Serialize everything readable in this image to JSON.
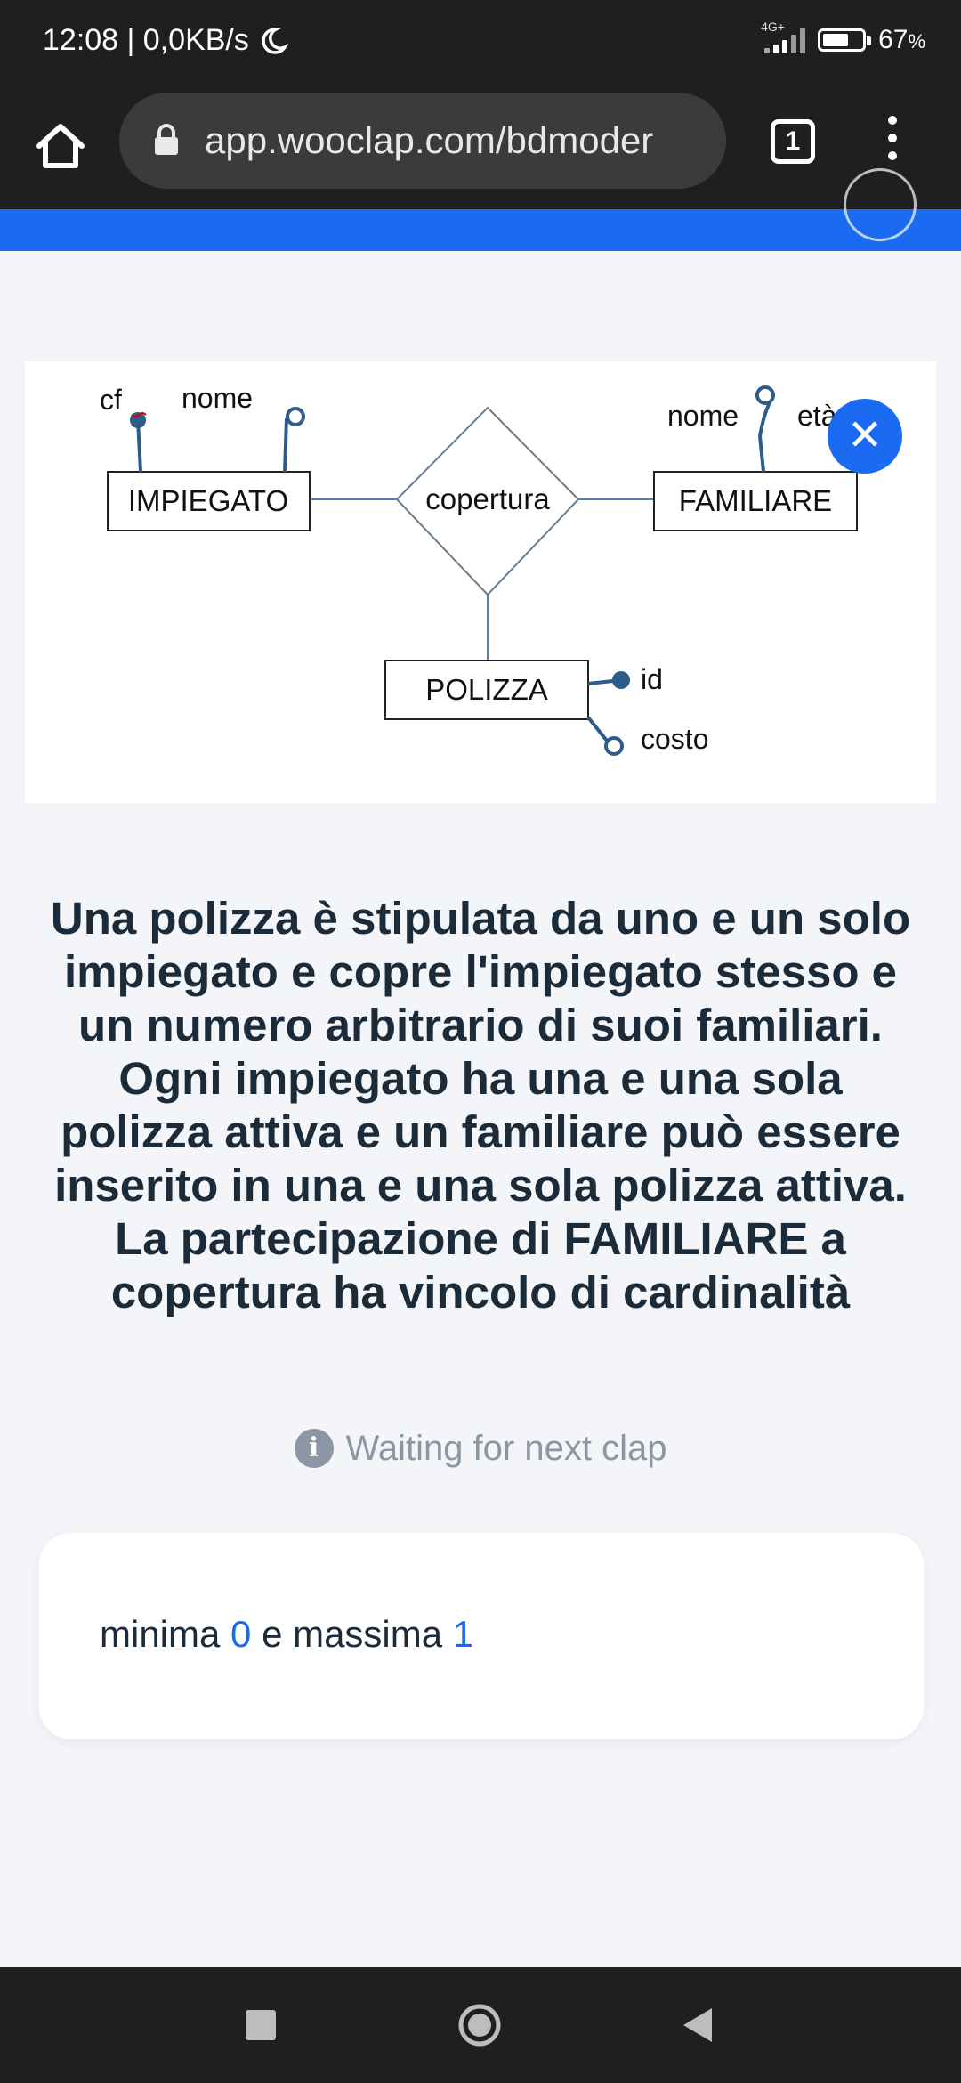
{
  "status_bar": {
    "time_speed": "12:08 | 0,0KB/s",
    "network": "4G+",
    "battery": "67",
    "battery_unit": "%",
    "battery_level": 0.67
  },
  "browser": {
    "url": "app.wooclap.com/bdmoder",
    "tab_count": "1"
  },
  "diagram": {
    "entities": [
      "IMPIEGATO",
      "FAMILIARE",
      "POLIZZA"
    ],
    "relationship": "copertura",
    "attributes": {
      "impiegato": [
        "cf",
        "nome"
      ],
      "familiare": [
        "nome",
        "età"
      ],
      "polizza": [
        "id",
        "costo"
      ]
    }
  },
  "question": {
    "lines": [
      "Una polizza è stipulata da uno e un solo",
      "impiegato e copre l'impiegato stesso e",
      "un numero arbitrario di suoi familiari.",
      "Ogni impiegato ha una e una sola",
      "polizza attiva e un familiare può essere",
      "inserito in una e una sola polizza attiva.",
      "La partecipazione di FAMILIARE a",
      "copertura ha vincolo di cardinalità"
    ]
  },
  "status_message": "Waiting for next clap",
  "answer": {
    "prefix": "minima",
    "min_value": "0",
    "middle": "e massima",
    "max_value": "1"
  },
  "colors": {
    "accent": "#1a6bf2",
    "text": "#1c2b3a",
    "muted": "#8c96a4",
    "system_bar": "#1f1f1f"
  }
}
